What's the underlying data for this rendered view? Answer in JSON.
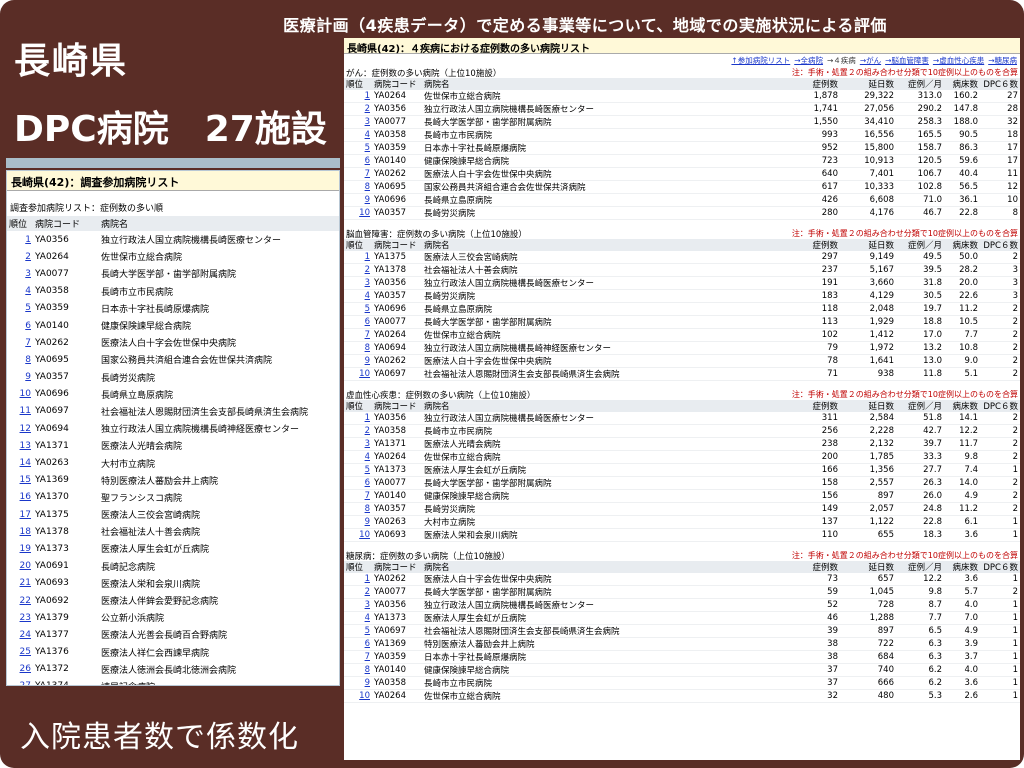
{
  "slide": {
    "title": "医療計画（4疾患データ）で定める事業等について、地域での実施状況による評価",
    "prefecture": "長崎県",
    "dpc_label": "DPC病院　27施設",
    "bottom_label": "入院患者数で係数化"
  },
  "left": {
    "header": "長崎県(42)：調査参加病院リスト",
    "subtitle": "調査参加病院リスト：症例数の多い順",
    "columns": [
      "順位",
      "病院コード",
      "病院名"
    ],
    "rows": [
      [
        "1",
        "YA0356",
        "独立行政法人国立病院機構長崎医療センター"
      ],
      [
        "2",
        "YA0264",
        "佐世保市立総合病院"
      ],
      [
        "3",
        "YA0077",
        "長崎大学医学部・歯学部附属病院"
      ],
      [
        "4",
        "YA0358",
        "長崎市立市民病院"
      ],
      [
        "5",
        "YA0359",
        "日本赤十字社長崎原爆病院"
      ],
      [
        "6",
        "YA0140",
        "健康保険諫早総合病院"
      ],
      [
        "7",
        "YA0262",
        "医療法人白十字会佐世保中央病院"
      ],
      [
        "8",
        "YA0695",
        "国家公務員共済組合連合会佐世保共済病院"
      ],
      [
        "9",
        "YA0357",
        "長崎労災病院"
      ],
      [
        "10",
        "YA0696",
        "長崎県立島原病院"
      ],
      [
        "11",
        "YA0697",
        "社会福祉法人恩賜財団済生会支部長崎県済生会病院"
      ],
      [
        "12",
        "YA0694",
        "独立行政法人国立病院機構長崎神経医療センター"
      ],
      [
        "13",
        "YA1371",
        "医療法人光晴会病院"
      ],
      [
        "14",
        "YA0263",
        "大村市立病院"
      ],
      [
        "15",
        "YA1369",
        "特別医療法人蕃励会井上病院"
      ],
      [
        "16",
        "YA1370",
        "聖フランシスコ病院"
      ],
      [
        "17",
        "YA1375",
        "医療法人三佼会宮崎病院"
      ],
      [
        "18",
        "YA1378",
        "社会福祉法人十善会病院"
      ],
      [
        "19",
        "YA1373",
        "医療法人厚生会虹が丘病院"
      ],
      [
        "20",
        "YA0691",
        "長崎記念病院"
      ],
      [
        "21",
        "YA0693",
        "医療法人栄和会泉川病院"
      ],
      [
        "22",
        "YA0692",
        "医療法人伴鉾会愛野記念病院"
      ],
      [
        "23",
        "YA1379",
        "公立新小浜病院"
      ],
      [
        "24",
        "YA1377",
        "医療法人光善会長崎百合野病院"
      ],
      [
        "25",
        "YA1376",
        "医療法人祥仁会西諫早病院"
      ],
      [
        "26",
        "YA1372",
        "医療法人徳洲会長崎北徳洲会病院"
      ],
      [
        "27",
        "YA1374",
        "諫早記念病院"
      ]
    ]
  },
  "right": {
    "header": "長崎県(42)：４疾病における症例数の多い病院リスト",
    "nav": [
      {
        "label": "↑参加病院リスト",
        "link": true
      },
      {
        "label": "→全病院",
        "link": true
      },
      {
        "label": "→４疾病",
        "link": false
      },
      {
        "label": "→がん",
        "link": true
      },
      {
        "label": "→脳血管障害",
        "link": true
      },
      {
        "label": "→虚血性心疾患",
        "link": true
      },
      {
        "label": "→糖尿病",
        "link": true
      }
    ],
    "columns": [
      "順位",
      "病院コード",
      "病院名",
      "症例数",
      "延日数",
      "症例／月",
      "病床数",
      "DPC６数"
    ],
    "sections": [
      {
        "caption": "がん：症例数の多い病院（上位10施設）",
        "note": "注：手術・処置２の組み合わせ分類で10症例以上のものを合算",
        "rows": [
          [
            "1",
            "YA0264",
            "佐世保市立総合病院",
            "1,878",
            "29,322",
            "313.0",
            "160.2",
            "27"
          ],
          [
            "2",
            "YA0356",
            "独立行政法人国立病院機構長崎医療センター",
            "1,741",
            "27,056",
            "290.2",
            "147.8",
            "28"
          ],
          [
            "3",
            "YA0077",
            "長崎大学医学部・歯学部附属病院",
            "1,550",
            "34,410",
            "258.3",
            "188.0",
            "32"
          ],
          [
            "4",
            "YA0358",
            "長崎市立市民病院",
            "993",
            "16,556",
            "165.5",
            "90.5",
            "18"
          ],
          [
            "5",
            "YA0359",
            "日本赤十字社長崎原爆病院",
            "952",
            "15,800",
            "158.7",
            "86.3",
            "17"
          ],
          [
            "6",
            "YA0140",
            "健康保険諫早総合病院",
            "723",
            "10,913",
            "120.5",
            "59.6",
            "17"
          ],
          [
            "7",
            "YA0262",
            "医療法人白十字会佐世保中央病院",
            "640",
            "7,401",
            "106.7",
            "40.4",
            "11"
          ],
          [
            "8",
            "YA0695",
            "国家公務員共済組合連合会佐世保共済病院",
            "617",
            "10,333",
            "102.8",
            "56.5",
            "12"
          ],
          [
            "9",
            "YA0696",
            "長崎県立島原病院",
            "426",
            "6,608",
            "71.0",
            "36.1",
            "10"
          ],
          [
            "10",
            "YA0357",
            "長崎労災病院",
            "280",
            "4,176",
            "46.7",
            "22.8",
            "8"
          ]
        ]
      },
      {
        "caption": "脳血管障害：症例数の多い病院（上位10施設）",
        "note": "注：手術・処置２の組み合わせ分類で10症例以上のものを合算",
        "rows": [
          [
            "1",
            "YA1375",
            "医療法人三佼会宮崎病院",
            "297",
            "9,149",
            "49.5",
            "50.0",
            "2"
          ],
          [
            "2",
            "YA1378",
            "社会福祉法人十善会病院",
            "237",
            "5,167",
            "39.5",
            "28.2",
            "3"
          ],
          [
            "3",
            "YA0356",
            "独立行政法人国立病院機構長崎医療センター",
            "191",
            "3,660",
            "31.8",
            "20.0",
            "3"
          ],
          [
            "4",
            "YA0357",
            "長崎労災病院",
            "183",
            "4,129",
            "30.5",
            "22.6",
            "3"
          ],
          [
            "5",
            "YA0696",
            "長崎県立島原病院",
            "118",
            "2,048",
            "19.7",
            "11.2",
            "2"
          ],
          [
            "6",
            "YA0077",
            "長崎大学医学部・歯学部附属病院",
            "113",
            "1,929",
            "18.8",
            "10.5",
            "2"
          ],
          [
            "7",
            "YA0264",
            "佐世保市立総合病院",
            "102",
            "1,412",
            "17.0",
            "7.7",
            "2"
          ],
          [
            "8",
            "YA0694",
            "独立行政法人国立病院機構長崎神経医療センター",
            "79",
            "1,972",
            "13.2",
            "10.8",
            "2"
          ],
          [
            "9",
            "YA0262",
            "医療法人白十字会佐世保中央病院",
            "78",
            "1,641",
            "13.0",
            "9.0",
            "2"
          ],
          [
            "10",
            "YA0697",
            "社会福祉法人恩賜財団済生会支部長崎県済生会病院",
            "71",
            "938",
            "11.8",
            "5.1",
            "2"
          ]
        ]
      },
      {
        "caption": "虚血性心疾患：症例数の多い病院（上位10施設）",
        "note": "注：手術・処置２の組み合わせ分類で10症例以上のものを合算",
        "rows": [
          [
            "1",
            "YA0356",
            "独立行政法人国立病院機構長崎医療センター",
            "311",
            "2,584",
            "51.8",
            "14.1",
            "2"
          ],
          [
            "2",
            "YA0358",
            "長崎市立市民病院",
            "256",
            "2,228",
            "42.7",
            "12.2",
            "2"
          ],
          [
            "3",
            "YA1371",
            "医療法人光晴会病院",
            "238",
            "2,132",
            "39.7",
            "11.7",
            "2"
          ],
          [
            "4",
            "YA0264",
            "佐世保市立総合病院",
            "200",
            "1,785",
            "33.3",
            "9.8",
            "2"
          ],
          [
            "5",
            "YA1373",
            "医療法人厚生会虹が丘病院",
            "166",
            "1,356",
            "27.7",
            "7.4",
            "1"
          ],
          [
            "6",
            "YA0077",
            "長崎大学医学部・歯学部附属病院",
            "158",
            "2,557",
            "26.3",
            "14.0",
            "2"
          ],
          [
            "7",
            "YA0140",
            "健康保険諫早総合病院",
            "156",
            "897",
            "26.0",
            "4.9",
            "2"
          ],
          [
            "8",
            "YA0357",
            "長崎労災病院",
            "149",
            "2,057",
            "24.8",
            "11.2",
            "2"
          ],
          [
            "9",
            "YA0263",
            "大村市立病院",
            "137",
            "1,122",
            "22.8",
            "6.1",
            "1"
          ],
          [
            "10",
            "YA0693",
            "医療法人栄和会泉川病院",
            "110",
            "655",
            "18.3",
            "3.6",
            "1"
          ]
        ]
      },
      {
        "caption": "糖尿病：症例数の多い病院（上位10施設）",
        "note": "注：手術・処置２の組み合わせ分類で10症例以上のものを合算",
        "rows": [
          [
            "1",
            "YA0262",
            "医療法人白十字会佐世保中央病院",
            "73",
            "657",
            "12.2",
            "3.6",
            "1"
          ],
          [
            "2",
            "YA0077",
            "長崎大学医学部・歯学部附属病院",
            "59",
            "1,045",
            "9.8",
            "5.7",
            "2"
          ],
          [
            "3",
            "YA0356",
            "独立行政法人国立病院機構長崎医療センター",
            "52",
            "728",
            "8.7",
            "4.0",
            "1"
          ],
          [
            "4",
            "YA1373",
            "医療法人厚生会虹が丘病院",
            "46",
            "1,288",
            "7.7",
            "7.0",
            "1"
          ],
          [
            "5",
            "YA0697",
            "社会福祉法人恩賜財団済生会支部長崎県済生会病院",
            "39",
            "897",
            "6.5",
            "4.9",
            "1"
          ],
          [
            "6",
            "YA1369",
            "特別医療法人蕃励会井上病院",
            "38",
            "722",
            "6.3",
            "3.9",
            "1"
          ],
          [
            "7",
            "YA0359",
            "日本赤十字社長崎原爆病院",
            "38",
            "684",
            "6.3",
            "3.7",
            "1"
          ],
          [
            "8",
            "YA0140",
            "健康保険諫早総合病院",
            "37",
            "740",
            "6.2",
            "4.0",
            "1"
          ],
          [
            "9",
            "YA0358",
            "長崎市立市民病院",
            "37",
            "666",
            "6.2",
            "3.6",
            "1"
          ],
          [
            "10",
            "YA0264",
            "佐世保市立総合病院",
            "32",
            "480",
            "5.3",
            "2.6",
            "1"
          ]
        ]
      }
    ]
  }
}
